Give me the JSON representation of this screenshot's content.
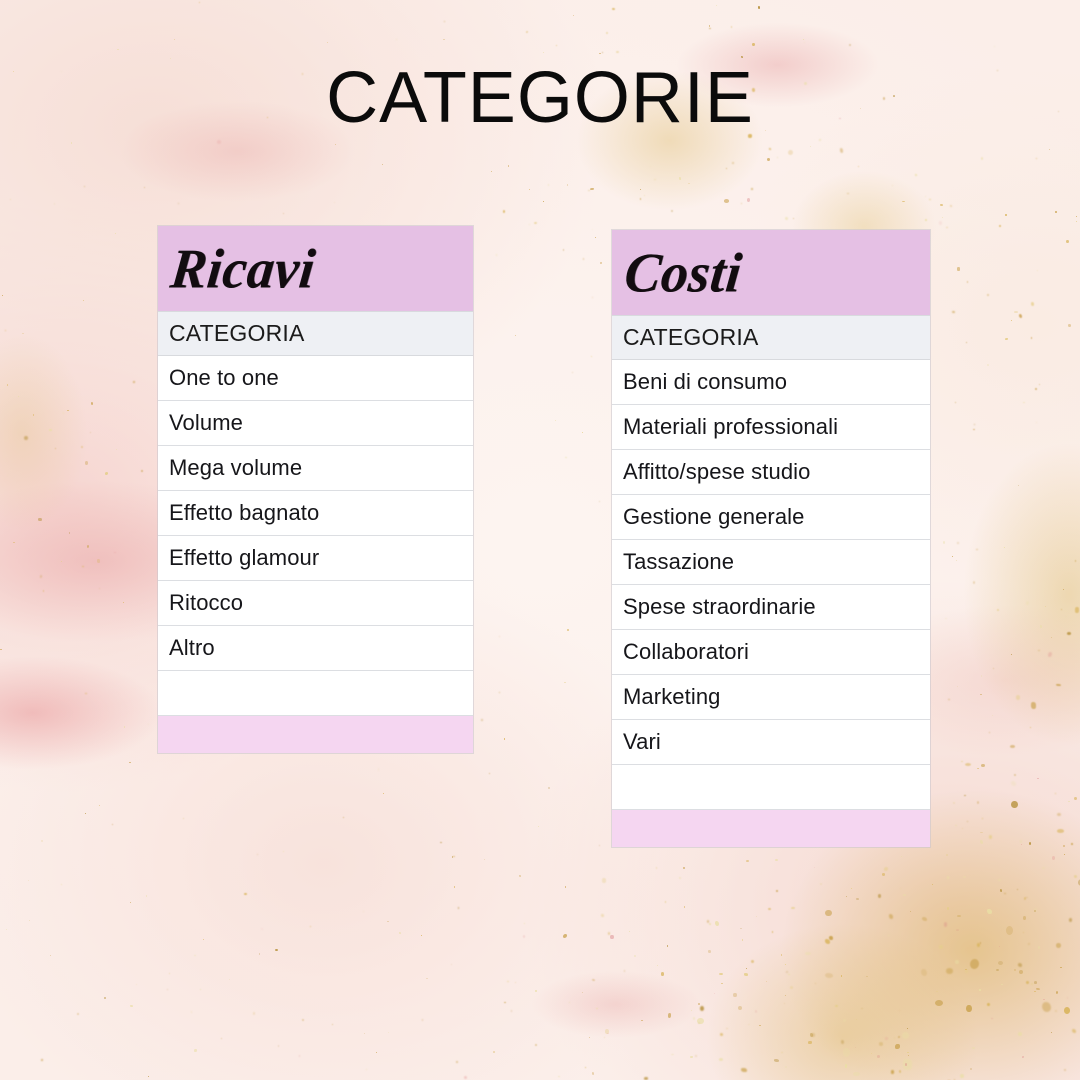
{
  "page": {
    "title": "CATEGORIE",
    "background_description": "pale pink marble with gold glitter flecks",
    "colors": {
      "banner_pink": "#e5c0e4",
      "footer_pink": "#f5d6f1",
      "column_header_gray": "#eef0f4",
      "row_background": "#ffffff",
      "row_border": "#dcdee2",
      "title_text": "#0b0b0b",
      "body_text": "#16161a"
    }
  },
  "tables": [
    {
      "id": "ricavi",
      "banner": "Ricavi",
      "column_header": "CATEGORIA",
      "rows": [
        "One to one",
        "Volume",
        "Mega volume",
        "Effetto bagnato",
        "Effetto glamour",
        "Ritocco",
        "Altro",
        ""
      ],
      "has_footer": true
    },
    {
      "id": "costi",
      "banner": "Costi",
      "column_header": "CATEGORIA",
      "rows": [
        "Beni di consumo",
        "Materiali professionali",
        "Affitto/spese studio",
        "Gestione generale",
        "Tassazione",
        "Spese straordinarie",
        "Collaboratori",
        "Marketing",
        "Vari",
        ""
      ],
      "has_footer": true
    }
  ]
}
